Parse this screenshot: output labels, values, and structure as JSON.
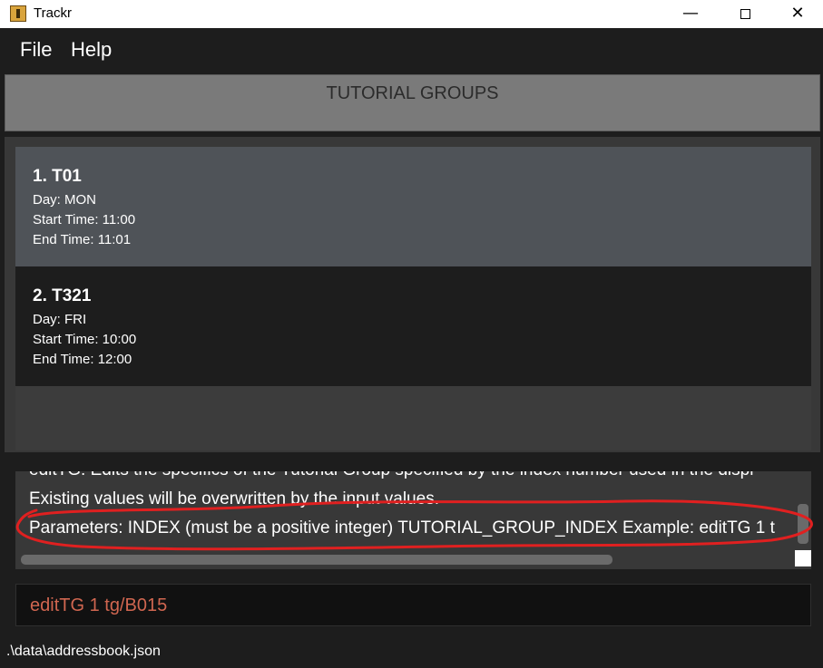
{
  "window": {
    "title": "Trackr",
    "controls": {
      "minimize": "—",
      "close": "✕"
    }
  },
  "menu": {
    "file": "File",
    "help": "Help"
  },
  "header": {
    "title": "TUTORIAL GROUPS"
  },
  "tutorial_groups": [
    {
      "name": "1.  T01",
      "day": "Day: MON",
      "start": "Start Time: 11:00",
      "end": "End Time: 11:01"
    },
    {
      "name": "2.  T321",
      "day": "Day: FRI",
      "start": "Start Time: 10:00",
      "end": "End Time: 12:00"
    }
  ],
  "result": {
    "line1": "editTG: Edits the specifics of the Tutorial Group specified by the index number used in the displ",
    "line2": "Existing values will be overwritten by the input values.",
    "line3": "Parameters: INDEX (must be a positive integer) TUTORIAL_GROUP_INDEX Example: editTG 1 t"
  },
  "command": {
    "value": "editTG 1 tg/B015"
  },
  "status": {
    "path": ".\\data\\addressbook.json"
  },
  "colors": {
    "background": "#1d1d1d",
    "selected_item": "#4f5358",
    "command_text": "#d06650",
    "annotation": "#e02020"
  }
}
